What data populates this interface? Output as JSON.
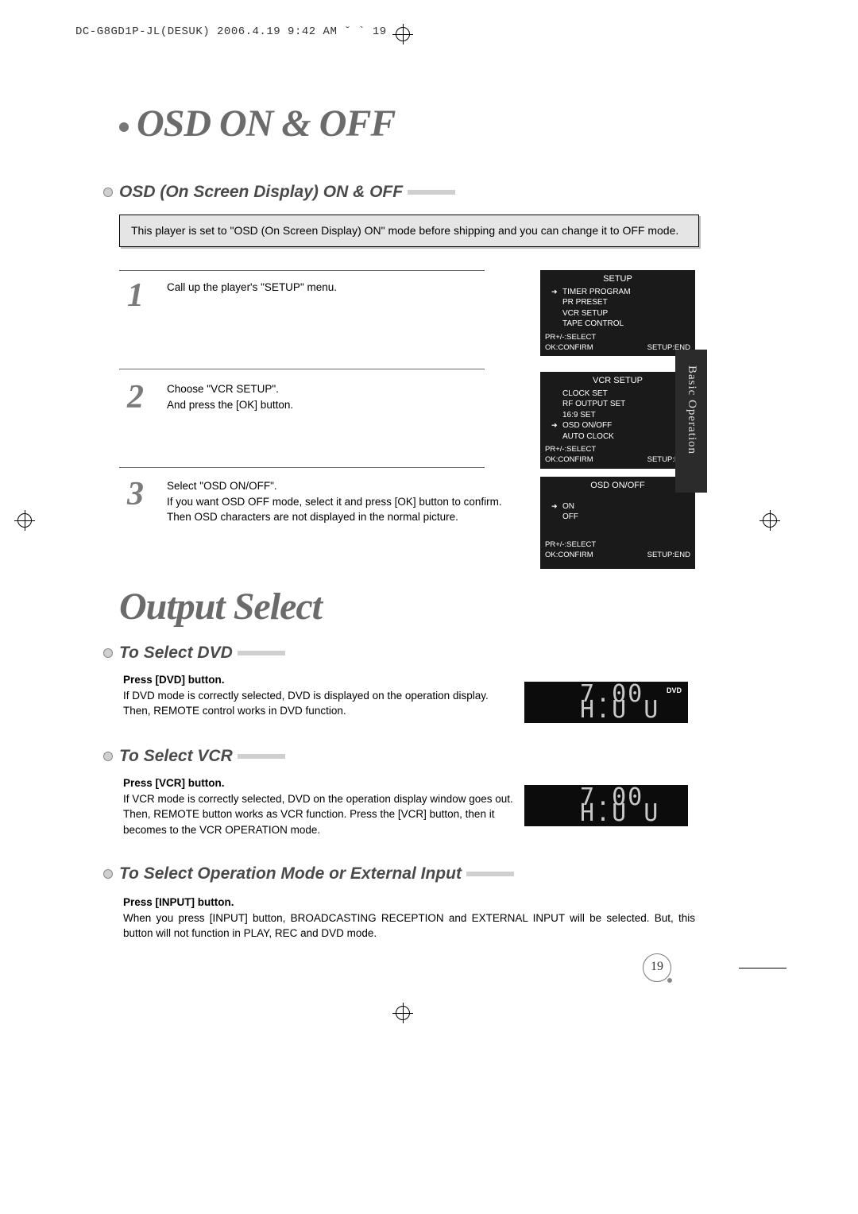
{
  "print_header": "DC-G8GD1P-JL(DESUK)  2006.4.19 9:42 AM  ˘ ` 19",
  "title_osd": "OSD ON & OFF",
  "title_output": "Output Select",
  "section_osd_sub": "OSD (On Screen Display) ON & OFF",
  "lead_box": "This player is set to \"OSD (On Screen Display) ON\" mode before shipping and you can change it to OFF mode.",
  "steps": {
    "1": "Call up the player's \"SETUP\" menu.",
    "2a": "Choose \"VCR SETUP\".",
    "2b": "And press the [OK] button.",
    "3a": "Select \"OSD ON/OFF\".",
    "3b": "If you want OSD OFF mode, select it and press [OK] button to confirm.",
    "3c": "Then OSD characters are not displayed in the normal picture."
  },
  "osd_menu1": {
    "title": "SETUP",
    "items": [
      "TIMER PROGRAM",
      "PR PRESET",
      "VCR SETUP",
      "TAPE CONTROL"
    ],
    "foot_l1": "PR+/-:SELECT",
    "foot_l2": "OK:CONFIRM",
    "foot_r": "SETUP:END"
  },
  "osd_menu2": {
    "title": "VCR SETUP",
    "items": [
      "CLOCK SET",
      "RF OUTPUT SET",
      "16:9 SET",
      "OSD ON/OFF",
      "AUTO CLOCK"
    ],
    "foot_l1": "PR+/-:SELECT",
    "foot_l2": "OK:CONFIRM",
    "foot_r": "SETUP:END"
  },
  "osd_menu3": {
    "title": "OSD ON/OFF",
    "items": [
      "ON",
      "OFF"
    ],
    "foot_l1": "PR+/-:SELECT",
    "foot_l2": "OK:CONFIRM",
    "foot_r": "SETUP:END"
  },
  "side_tab": "Basic Operation",
  "sec_dvd_h": "To Select DVD",
  "sec_dvd_b": "Press [DVD] button.",
  "sec_dvd_t": "If DVD mode is correctly selected, DVD is displayed on the operation display. Then, REMOTE control works in DVD function.",
  "sec_vcr_h": "To Select VCR",
  "sec_vcr_b": "Press [VCR] button.",
  "sec_vcr_t": "If VCR mode is correctly selected, DVD on the operation display window goes out. Then, REMOTE button works as VCR function. Press the [VCR] button, then it becomes to the VCR OPERATION mode.",
  "sec_opmode_h": "To Select Operation Mode or External Input",
  "sec_opmode_b": "Press [INPUT] button.",
  "sec_opmode_t": "When you press [INPUT] button, BROADCASTING RECEPTION and EXTERNAL INPUT will be selected. But, this button will not function in PLAY, REC and DVD mode.",
  "display_seg_top": "7.00",
  "display_seg_bot": "H.U U",
  "dvd_tag": "DVD",
  "page_no": "19"
}
